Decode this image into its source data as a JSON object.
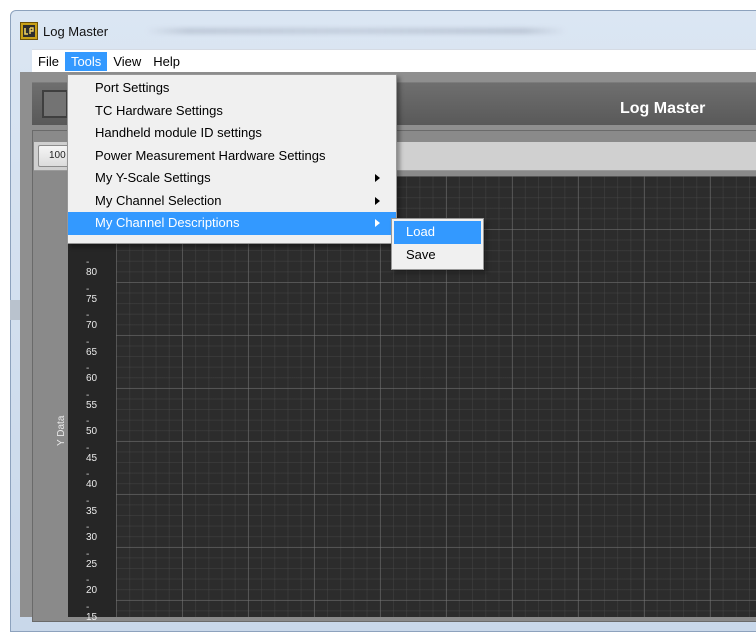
{
  "window": {
    "title": "Log Master"
  },
  "menubar": {
    "items": [
      {
        "label": "File"
      },
      {
        "label": "Tools"
      },
      {
        "label": "View"
      },
      {
        "label": "Help"
      }
    ],
    "active": "Tools"
  },
  "tools_menu": {
    "items": [
      {
        "label": "Port Settings"
      },
      {
        "label": "TC Hardware Settings"
      },
      {
        "label": "Handheld module  ID settings"
      },
      {
        "label": "Power Measurement Hardware Settings"
      },
      {
        "label": "My Y-Scale Settings",
        "has_submenu": true
      },
      {
        "label": "My Channel Selection",
        "has_submenu": true
      },
      {
        "label": "My Channel Descriptions",
        "has_submenu": true,
        "highlighted": true
      }
    ]
  },
  "submenu": {
    "items": [
      {
        "label": "Load",
        "highlighted": true
      },
      {
        "label": "Save"
      }
    ]
  },
  "header": {
    "title": "Log Master"
  },
  "toolbar": {
    "zoom_label": "100"
  },
  "chart": {
    "y_axis_label": "Y Data",
    "y_ticks": [
      "80",
      "75",
      "70",
      "65",
      "60",
      "55",
      "50",
      "45",
      "40",
      "35",
      "30",
      "25",
      "20",
      "15"
    ]
  },
  "colors": {
    "accent": "#3399ff",
    "plot_background": "#2c2c2c",
    "header_background": "#666666"
  },
  "icons": {
    "app": "labview-vi-icon",
    "submenu_arrow": "chevron-right-icon"
  }
}
